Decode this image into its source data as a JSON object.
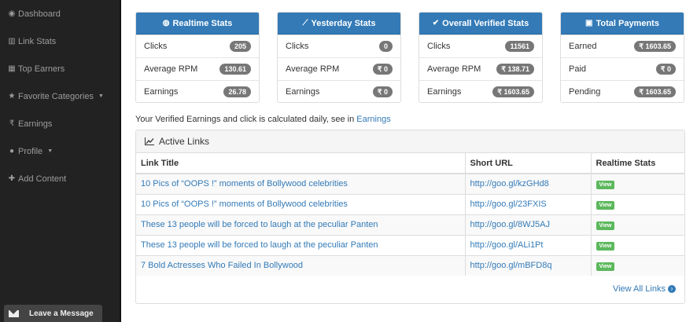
{
  "sidebar": {
    "items": [
      {
        "label": "Dashboard",
        "icon": "dashboard-icon"
      },
      {
        "label": "Link Stats",
        "icon": "bar-chart-icon"
      },
      {
        "label": "Top Earners",
        "icon": "table-icon"
      },
      {
        "label": "Favorite Categories",
        "icon": "star-icon",
        "dropdown": true
      },
      {
        "label": "Earnings",
        "icon": "rupee-icon"
      },
      {
        "label": "Profile",
        "icon": "user-icon",
        "dropdown": true
      },
      {
        "label": "Add Content",
        "icon": "plus-icon"
      }
    ],
    "leave_message": "Leave a Message"
  },
  "stats": [
    {
      "title": "Realtime Stats",
      "icon": "globe-icon",
      "rows": [
        {
          "label": "Clicks",
          "value": "205"
        },
        {
          "label": "Average RPM",
          "value": "130.61"
        },
        {
          "label": "Earnings",
          "value": "26.78"
        }
      ]
    },
    {
      "title": "Yesterday Stats",
      "icon": "line-chart-icon",
      "rows": [
        {
          "label": "Clicks",
          "value": "0"
        },
        {
          "label": "Average RPM",
          "value": "₹ 0"
        },
        {
          "label": "Earnings",
          "value": "₹ 0"
        }
      ]
    },
    {
      "title": "Overall Verified Stats",
      "icon": "check-circle-icon",
      "rows": [
        {
          "label": "Clicks",
          "value": "11561"
        },
        {
          "label": "Average RPM",
          "value": "₹ 138.71"
        },
        {
          "label": "Earnings",
          "value": "₹ 1603.65"
        }
      ]
    },
    {
      "title": "Total Payments",
      "icon": "money-icon",
      "rows": [
        {
          "label": "Earned",
          "value": "₹ 1603.65"
        },
        {
          "label": "Paid",
          "value": "₹ 0"
        },
        {
          "label": "Pending",
          "value": "₹ 1603.65"
        }
      ]
    }
  ],
  "note": {
    "text": "Your Verified Earnings and click is calculated daily, see in ",
    "link": "Earnings"
  },
  "active_links": {
    "title": "Active Links",
    "headers": [
      "Link Title",
      "Short URL",
      "Realtime Stats"
    ],
    "rows": [
      {
        "title": "10 Pics of “OOPS !” moments of Bollywood celebrities",
        "url": "http://goo.gl/kzGHd8",
        "action": "View"
      },
      {
        "title": "10 Pics of “OOPS !” moments of Bollywood celebrities",
        "url": "http://goo.gl/23FXIS",
        "action": "View"
      },
      {
        "title": "These 13 people will be forced to laugh at the peculiar Panten",
        "url": "http://goo.gl/8WJ5AJ",
        "action": "View"
      },
      {
        "title": "These 13 people will be forced to laugh at the peculiar Panten",
        "url": "http://goo.gl/ALi1Pt",
        "action": "View"
      },
      {
        "title": "7 Bold Actresses Who Failed In Bollywood",
        "url": "http://goo.gl/mBFD8q",
        "action": "View"
      }
    ],
    "view_all": "View All Links"
  },
  "colors": {
    "primary": "#337ab7",
    "success": "#5cb85c",
    "sidebar": "#222222",
    "badge": "#777777"
  }
}
